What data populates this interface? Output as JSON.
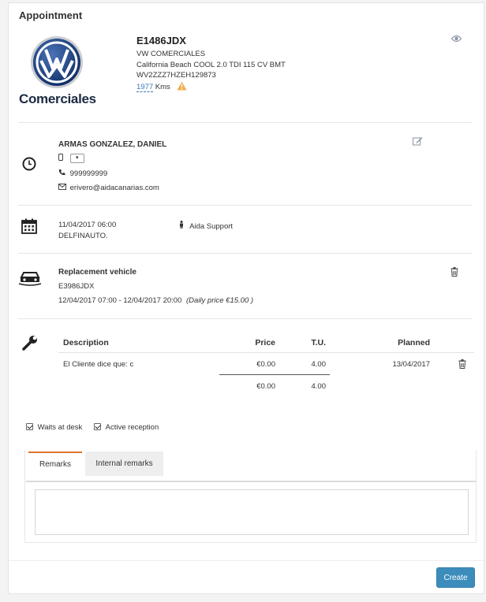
{
  "title": "Appointment",
  "vehicle": {
    "brand": "Comerciales",
    "plate": "E1486JDX",
    "make": "VW COMERCIALES",
    "model": "California Beach COOL 2.0 TDI 115 CV BMT",
    "vin": "WV2ZZZ7HZEH129873",
    "kms_value": "1977",
    "kms_unit": "Kms"
  },
  "customer": {
    "name": "ARMAS GONZALEZ, DANIEL",
    "dropdown_value": "▾",
    "phone": "999999999",
    "email": "erivero@aidacanarias.com"
  },
  "schedule": {
    "datetime": "11/04/2017 06:00",
    "workshop": "DELFINAUTO.",
    "advisor": "Aida Support"
  },
  "replacement": {
    "heading": "Replacement vehicle",
    "plate": "E3986JDX",
    "period": "12/04/2017 07:00 - 12/04/2017 20:00",
    "daily_price": "(Daily price €15.00 )"
  },
  "tasks": {
    "headers": {
      "description": "Description",
      "price": "Price",
      "tu": "T.U.",
      "planned": "Planned"
    },
    "rows": [
      {
        "description": "El Cliente dice que: c",
        "price": "€0.00",
        "tu": "4.00",
        "planned": "13/04/2017"
      }
    ],
    "totals": {
      "price": "€0.00",
      "tu": "4.00"
    }
  },
  "options": {
    "waits_at_desk": "Waits at desk",
    "active_reception": "Active reception"
  },
  "tabs": {
    "remarks": "Remarks",
    "internal_remarks": "Internal remarks"
  },
  "remarks_value": "",
  "actions": {
    "create": "Create"
  },
  "colors": {
    "accent": "#e0722d",
    "primary_button": "#3c8dbc",
    "warning": "#f0ad4e",
    "link": "#3a78b8"
  }
}
